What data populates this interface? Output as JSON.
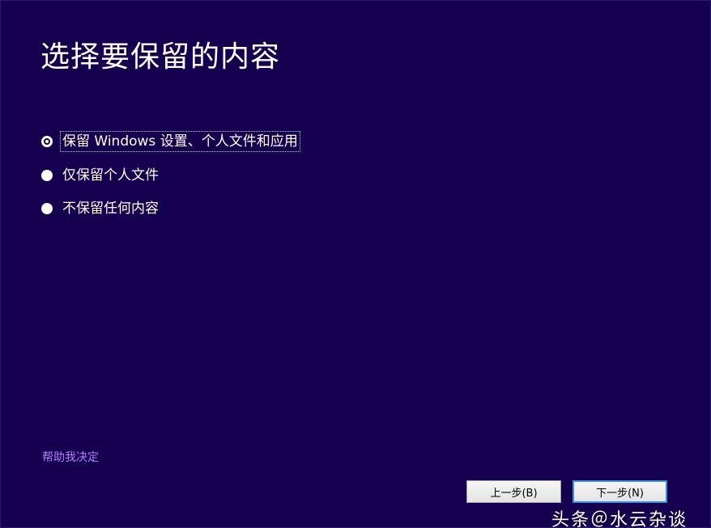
{
  "page": {
    "title": "选择要保留的内容"
  },
  "options": [
    {
      "label": "保留 Windows 设置、个人文件和应用",
      "selected": true
    },
    {
      "label": "仅保留个人文件",
      "selected": false
    },
    {
      "label": "不保留任何内容",
      "selected": false
    }
  ],
  "help_link": "帮助我决定",
  "buttons": {
    "back": "上一步(B)",
    "next": "下一步(N)"
  },
  "watermark": "头条＠水云杂谈",
  "colors": {
    "background": "#14004f",
    "link": "#b57cff",
    "focus_border": "#3b8fd6"
  }
}
